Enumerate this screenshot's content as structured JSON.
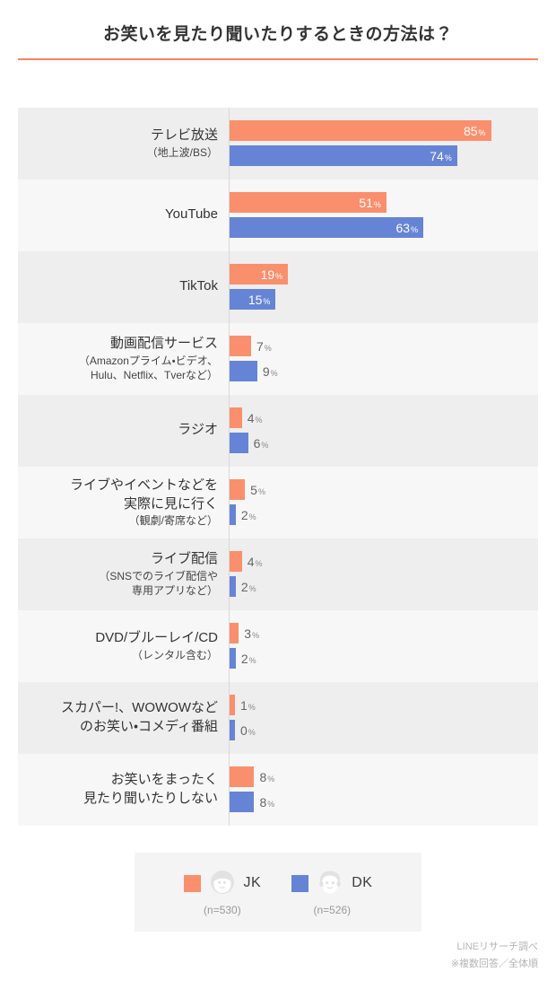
{
  "header": {
    "title": "お笑いを見たり聞いたりするときの方法は？",
    "rule_color": "#f9835f"
  },
  "legend": {
    "jk": {
      "label": "JK",
      "n": "(n=530)",
      "color": "#fa8f6d",
      "icon": "girl-face-icon"
    },
    "dk": {
      "label": "DK",
      "n": "(n=526)",
      "color": "#6684d6",
      "icon": "boy-face-icon"
    }
  },
  "footer": {
    "line1": "LINEリサーチ調べ",
    "line2": "※複数回答／全体順"
  },
  "chart_data": {
    "type": "bar",
    "orientation": "horizontal",
    "title": "お笑いを見たり聞いたりするときの方法は？",
    "xlabel": "",
    "ylabel": "",
    "xlim": [
      0,
      100
    ],
    "unit": "%",
    "grid": false,
    "legend_position": "bottom",
    "categories": [
      "テレビ放送（地上波/BS）",
      "YouTube",
      "TikTok",
      "動画配信サービス（Amazonプライム・ビデオ、Hulu、Netflix、Tverなど）",
      "ラジオ",
      "ライブやイベントなどを実際に見に行く（観劇/寄席など）",
      "ライブ配信（SNSでのライブ配信や専用アプリなど）",
      "DVD/ブルーレイ/CD（レンタル含む）",
      "スカパー!、WOWOWなどのお笑い・コメディ番組",
      "お笑いをまったく見たり聞いたりしない"
    ],
    "series": [
      {
        "name": "JK",
        "color": "#fa8f6d",
        "values": [
          85,
          51,
          19,
          7,
          4,
          5,
          4,
          3,
          1,
          8
        ]
      },
      {
        "name": "DK",
        "color": "#6684d6",
        "values": [
          74,
          63,
          15,
          9,
          6,
          2,
          2,
          2,
          0,
          8
        ]
      }
    ]
  },
  "rows": [
    {
      "main": "テレビ放送",
      "sub": "（地上波/BS）",
      "jk": "85",
      "dk": "74",
      "jk_inside": true,
      "dk_inside": true
    },
    {
      "main": "YouTube",
      "sub": "",
      "jk": "51",
      "dk": "63",
      "jk_inside": true,
      "dk_inside": true
    },
    {
      "main": "TikTok",
      "sub": "",
      "jk": "19",
      "dk": "15",
      "jk_inside": true,
      "dk_inside": true
    },
    {
      "main": "動画配信サービス",
      "sub": "（Amazonプライム・ビデオ、\nHulu、Netflix、Tverなど）",
      "jk": "7",
      "dk": "9",
      "jk_inside": false,
      "dk_inside": false
    },
    {
      "main": "ラジオ",
      "sub": "",
      "jk": "4",
      "dk": "6",
      "jk_inside": false,
      "dk_inside": false
    },
    {
      "main": "ライブやイベントなどを\n実際に見に行く",
      "sub": "（観劇/寄席など）",
      "jk": "5",
      "dk": "2",
      "jk_inside": false,
      "dk_inside": false
    },
    {
      "main": "ライブ配信",
      "sub": "（SNSでのライブ配信や\n専用アプリなど）",
      "jk": "4",
      "dk": "2",
      "jk_inside": false,
      "dk_inside": false
    },
    {
      "main": "DVD/ブルーレイ/CD",
      "sub": "（レンタル含む）",
      "jk": "3",
      "dk": "2",
      "jk_inside": false,
      "dk_inside": false
    },
    {
      "main": "スカパー!、WOWOWなど\nのお笑い・コメディ番組",
      "sub": "",
      "jk": "1",
      "dk": "0",
      "jk_inside": false,
      "dk_inside": false
    },
    {
      "main": "お笑いをまったく\n見たり聞いたりしない",
      "sub": "",
      "jk": "8",
      "dk": "8",
      "jk_inside": false,
      "dk_inside": false
    }
  ],
  "symbols": {
    "percent": "%"
  }
}
